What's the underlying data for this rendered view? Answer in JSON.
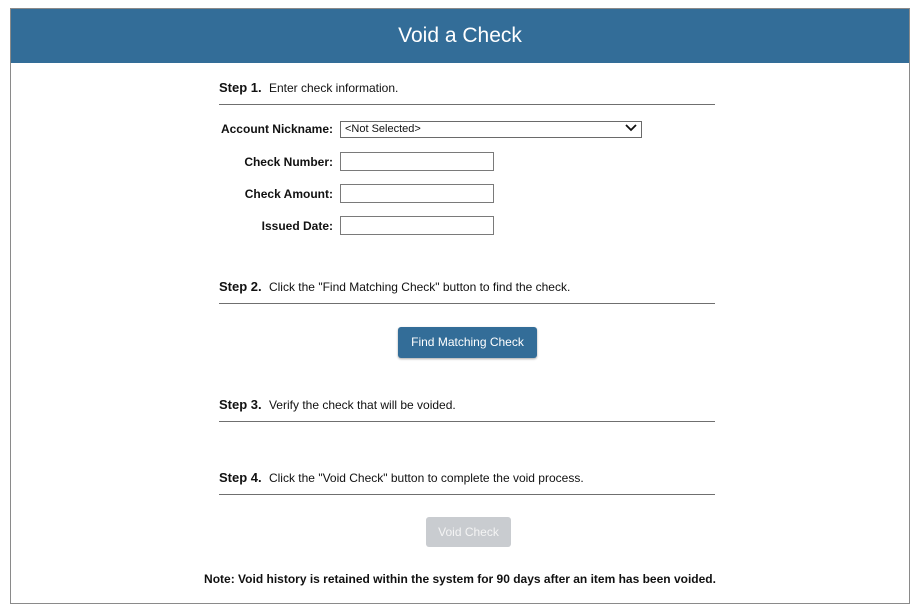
{
  "header": {
    "title": "Void a Check"
  },
  "steps": [
    {
      "number": "Step 1.",
      "text": "Enter check information."
    },
    {
      "number": "Step 2.",
      "text": "Click the \"Find Matching Check\" button to find the check."
    },
    {
      "number": "Step 3.",
      "text": "Verify the check that will be voided."
    },
    {
      "number": "Step 4.",
      "text": "Click the \"Void Check\" button to complete the void process."
    }
  ],
  "form": {
    "account_nickname": {
      "label": "Account Nickname:",
      "value": "<Not Selected>"
    },
    "check_number": {
      "label": "Check Number:",
      "value": ""
    },
    "check_amount": {
      "label": "Check Amount:",
      "value": ""
    },
    "issued_date": {
      "label": "Issued Date:",
      "value": ""
    }
  },
  "buttons": {
    "find_matching": "Find Matching Check",
    "void_check": "Void Check"
  },
  "note": "Note: Void history is retained within the system for 90 days after an item has been voided.",
  "colors": {
    "accent": "#336d98",
    "disabled": "#c9ccd0"
  },
  "icons": {
    "select_chevron": "chevron-down-icon"
  }
}
